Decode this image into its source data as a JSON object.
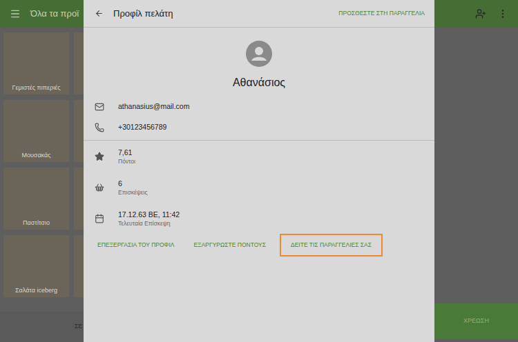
{
  "app_bar": {
    "title": "Όλα τα προϊ"
  },
  "products": [
    {
      "label": "Γεμιστές πιπεριές"
    },
    {
      "label": ""
    },
    {
      "label": "Μουσακάς"
    },
    {
      "label": ""
    },
    {
      "label": "Παστίτσιο"
    },
    {
      "label": ""
    },
    {
      "label": "Σαλάτα iceberg"
    },
    {
      "label": ""
    }
  ],
  "bottom_bar": {
    "left_button": "ΣΕ",
    "charge_button": "ΧΡΕΩΣΗ"
  },
  "dialog": {
    "title": "Προφίλ πελάτη",
    "action": "ΠΡΟΣΘΕΣΤΕ ΣΤΗ ΠΑΡΑΓΓΕΛΙΑ",
    "name": "Αθανάσιος",
    "contacts": [
      {
        "kind": "email",
        "value": "athanasius@mail.com"
      },
      {
        "kind": "phone",
        "value": "+30123456789"
      }
    ],
    "stats": [
      {
        "kind": "points",
        "value": "7,61",
        "label": "Πόντοι"
      },
      {
        "kind": "visits",
        "value": "6",
        "label": "Επισκέψεις"
      },
      {
        "kind": "last-visit",
        "value": "17.12.63 ΒΕ, 11:42",
        "label": "Τελευταία Επίσκεψη"
      }
    ],
    "buttons": [
      {
        "label": "ΕΠΕΞΕΡΓΑΣΙΑ ΤΟΥ ΠΡΟΦΙΛ",
        "highlighted": false
      },
      {
        "label": "ΕΞΑΡΓΥΡΩΣΤΕ ΠΟΝΤΟΥΣ",
        "highlighted": false
      },
      {
        "label": "ΔΕΙΤΕ ΤΙΣ ΠΑΡΑΓΓΕΛΙΕΣ ΣΑΣ",
        "highlighted": true
      }
    ]
  }
}
